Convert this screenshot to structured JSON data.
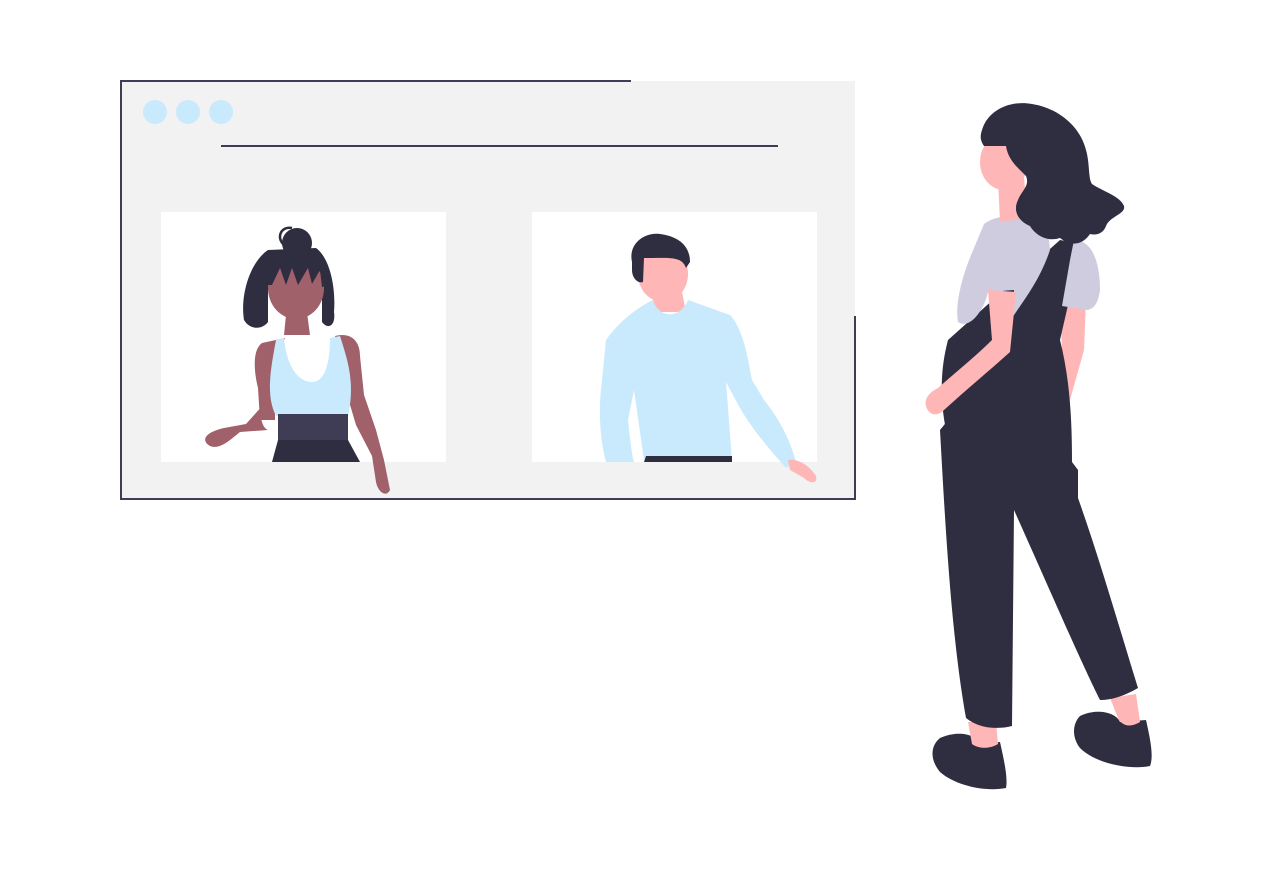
{
  "illustration": {
    "subject": "video-call",
    "window": {
      "dots": 3,
      "panels": 2
    },
    "palette": {
      "background": "#ffffff",
      "window_fill": "#f2f2f2",
      "panel_fill": "#ffffff",
      "outline": "#3f3d56",
      "dot": "#c9e9fd",
      "dark": "#2f2e41",
      "skin_light": "#ffb6b6",
      "skin_dark": "#a0616a",
      "shirt_blue": "#c9e9fd",
      "shirt_grey": "#cfcce0",
      "waistband": "#3f3d56"
    }
  }
}
